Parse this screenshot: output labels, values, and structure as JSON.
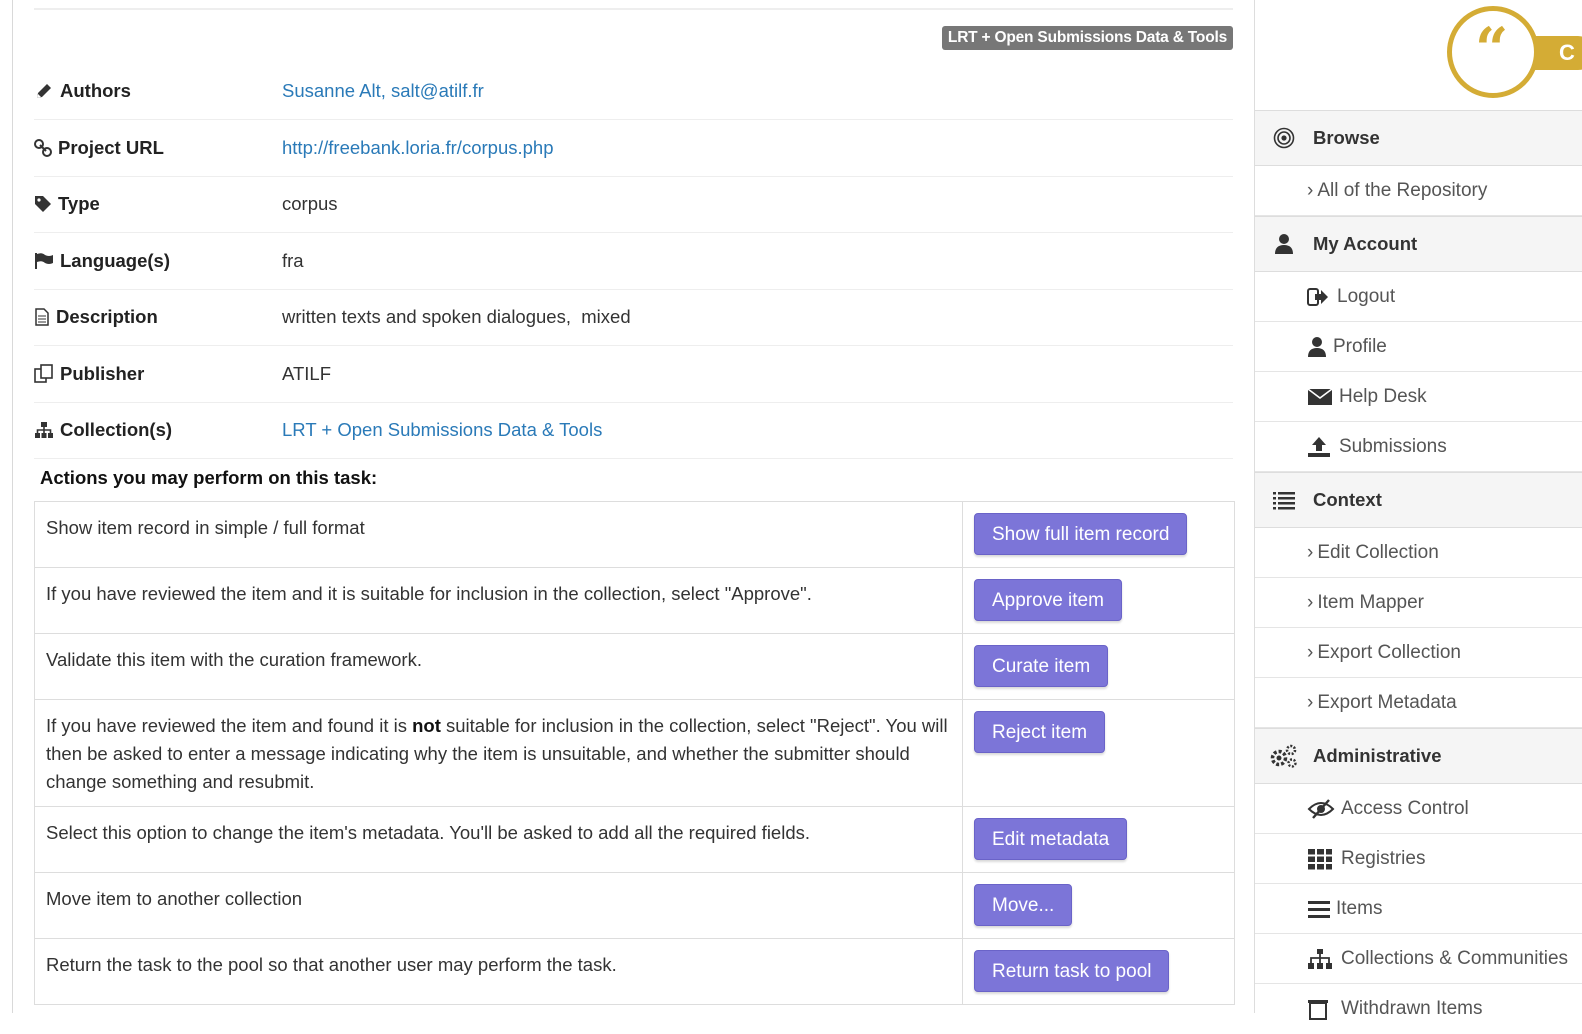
{
  "collection_badge": "LRT + Open Submissions Data & Tools",
  "metadata": {
    "authors": {
      "label": "Authors",
      "value": "Susanne Alt, salt@atilf.fr"
    },
    "project_url": {
      "label": "Project URL",
      "value": "http://freebank.loria.fr/corpus.php"
    },
    "type": {
      "label": "Type",
      "value": "corpus"
    },
    "languages": {
      "label": "Language(s)",
      "value": "fra"
    },
    "description": {
      "label": "Description",
      "value": "written texts and spoken dialogues,  mixed"
    },
    "publisher": {
      "label": "Publisher",
      "value": "ATILF"
    },
    "collections": {
      "label": "Collection(s)",
      "value": "LRT + Open Submissions Data & Tools"
    }
  },
  "actions": {
    "heading": "Actions you may perform on this task:",
    "rows": [
      {
        "desc": "Show item record in simple / full format",
        "button": "Show full item record"
      },
      {
        "desc": "If you have reviewed the item and it is suitable for inclusion in the collection, select \"Approve\".",
        "button": "Approve item"
      },
      {
        "desc": "Validate this item with the curation framework.",
        "button": "Curate item"
      },
      {
        "desc_before": "If you have reviewed the item and found it is ",
        "desc_bold": "not",
        "desc_after": " suitable for inclusion in the collection, select \"Reject\". You will then be asked to enter a message indicating why the item is unsuitable, and whether the submitter should change something and resubmit.",
        "button": "Reject item"
      },
      {
        "desc": "Select this option to change the item's metadata. You'll be asked to add all the required fields.",
        "button": "Edit metadata"
      },
      {
        "desc": "Move item to another collection",
        "button": "Move..."
      },
      {
        "desc": "Return the task to the pool so that another user may perform the task.",
        "button": "Return task to pool"
      }
    ]
  },
  "sidebar": {
    "logo_text": "C",
    "browse": {
      "title": "Browse",
      "items": [
        "All of the Repository"
      ]
    },
    "account": {
      "title": "My Account",
      "items": [
        "Logout",
        "Profile",
        "Help Desk",
        "Submissions"
      ]
    },
    "context": {
      "title": "Context",
      "items": [
        "Edit Collection",
        "Item Mapper",
        "Export Collection",
        "Export Metadata"
      ]
    },
    "admin": {
      "title": "Administrative",
      "items": [
        "Access Control",
        "Registries",
        "Items",
        "Collections & Communities",
        "Withdrawn Items"
      ]
    }
  },
  "colors": {
    "button": "#7c75d8",
    "link": "#2a7ab8",
    "badge": "#777777",
    "logo": "#d4ac35"
  }
}
